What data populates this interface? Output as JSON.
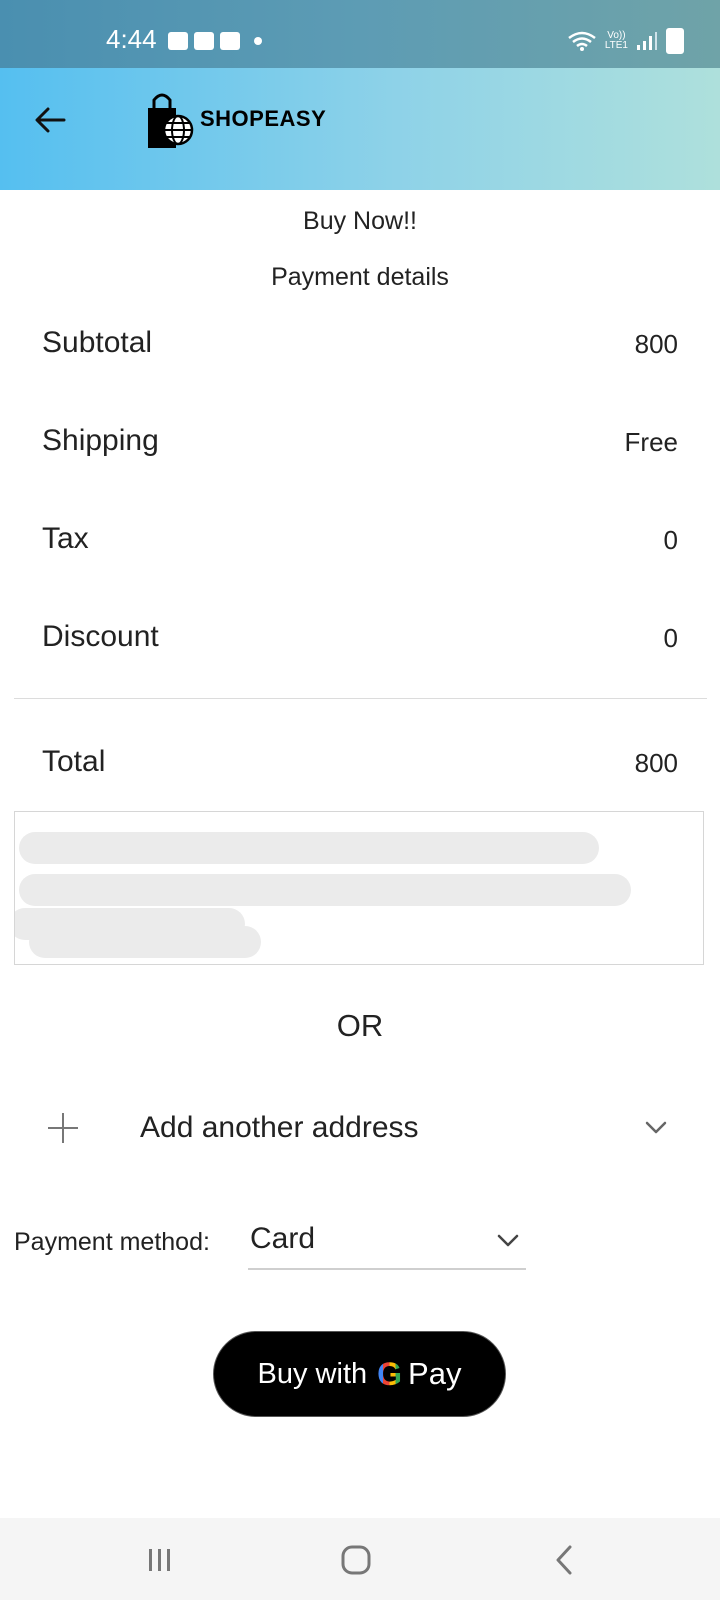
{
  "status_bar": {
    "time": "4:44",
    "network": "LTE1",
    "volte": "Vo))"
  },
  "app_bar": {
    "brand": "SHOPEASY",
    "back_icon": "arrow-left-icon",
    "logo_icon": "shopping-bag-globe-icon"
  },
  "heading": "Buy Now!!",
  "subheading": "Payment details",
  "summary": {
    "subtotal_label": "Subtotal",
    "subtotal_value": "800",
    "shipping_label": "Shipping",
    "shipping_value": "Free",
    "tax_label": "Tax",
    "tax_value": "0",
    "discount_label": "Discount",
    "discount_value": "0",
    "total_label": "Total",
    "total_value": "800"
  },
  "or_text": "OR",
  "add_address": {
    "label": "Add another address",
    "icon": "plus-icon",
    "chevron": "chevron-down-icon"
  },
  "payment": {
    "label": "Payment method:",
    "selected": "Card"
  },
  "gpay_button": {
    "prefix": "Buy with",
    "g": "G",
    "suffix": "Pay"
  },
  "colors": {
    "appbar_start": "#55bff0",
    "appbar_end": "#aee0dc",
    "gpay_bg": "#000000"
  }
}
